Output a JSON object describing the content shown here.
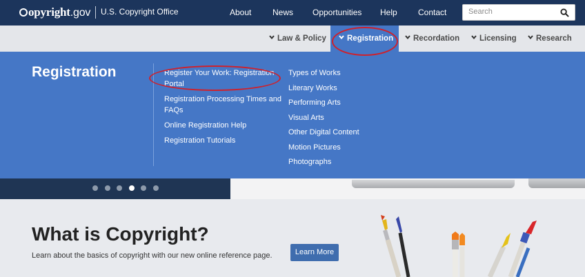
{
  "header": {
    "logo_text": "opyright",
    "logo_suffix": ".gov",
    "office": "U.S. Copyright Office",
    "nav": [
      "About",
      "News",
      "Opportunities",
      "Help",
      "Contact"
    ],
    "search": {
      "placeholder": "Search",
      "icon": "search-icon"
    }
  },
  "secondary_nav": {
    "items": [
      "Law & Policy",
      "Registration",
      "Recordation",
      "Licensing",
      "Research"
    ],
    "active": "Registration"
  },
  "mega_menu": {
    "title": "Registration",
    "column1": [
      "Register Your Work: Registration Portal",
      "Registration Processing Times and FAQs",
      "Online Registration Help",
      "Registration Tutorials"
    ],
    "column2": [
      "Types of Works",
      "Literary Works",
      "Performing Arts",
      "Visual Arts",
      "Other Digital Content",
      "Motion Pictures",
      "Photographs"
    ],
    "highlighted_item": "Register Your Work: Registration Portal"
  },
  "carousel": {
    "dot_count": 6,
    "active_index": 3
  },
  "hero": {
    "title": "What is Copyright?",
    "subtitle": "Learn about the basics of copyright with our new online reference page.",
    "button": "Learn More"
  },
  "colors": {
    "topbar": "#1c355c",
    "menu_blue": "#4577c6",
    "annotation_red": "#d0202a",
    "button_blue": "#3f6dae"
  }
}
